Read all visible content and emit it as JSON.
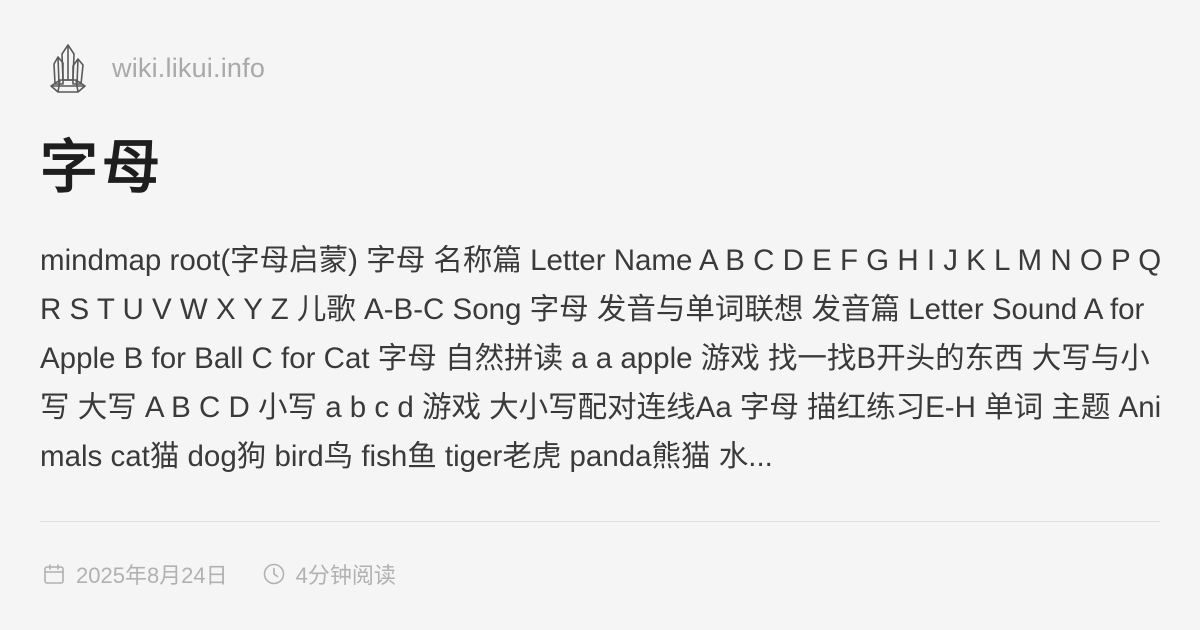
{
  "site": {
    "logo_icon": "crystal-cluster-icon",
    "url": "wiki.likui.info"
  },
  "article": {
    "title": "字母",
    "excerpt": "mindmap root(字母启蒙) 字母 名称篇 Letter Name A B C D E F G H I J K L M N O P Q R S T U V W X Y Z 儿歌 A-B-C Song 字母 发音与单词联想 发音篇 Letter Sound A for Apple B for Ball C for Cat 字母 自然拼读 a a apple 游戏 找一找B开头的东西 大写与小写 大写 A B C D 小写 a b c d 游戏 大小写配对连线Aa 字母 描红练习E-H 单词 主题 Animals cat猫 dog狗 bird鸟 fish鱼 tiger老虎 panda熊猫 水..."
  },
  "meta": {
    "date_icon": "calendar-icon",
    "date": "2025年8月24日",
    "read_icon": "clock-icon",
    "read_time": "4分钟阅读"
  },
  "colors": {
    "background": "#f6f5f5",
    "title": "#1e1e1e",
    "text": "#3a3a3a",
    "muted": "#a9a9a9",
    "divider": "#e2e0e0"
  }
}
